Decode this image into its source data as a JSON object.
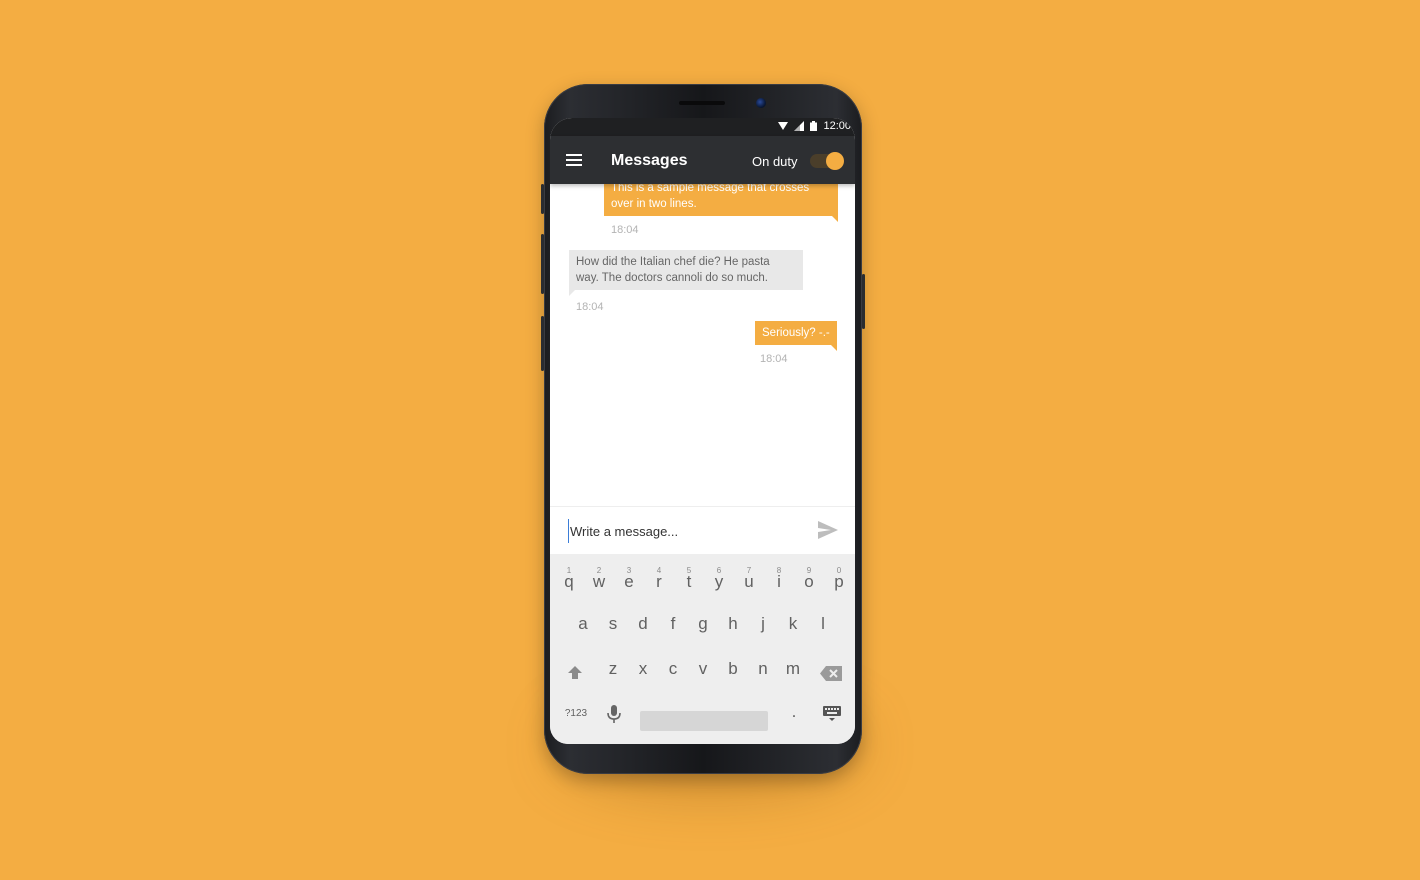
{
  "status_bar": {
    "time": "12:00"
  },
  "app_bar": {
    "title": "Messages",
    "duty_label": "On duty",
    "duty_on": true
  },
  "messages": [
    {
      "direction": "out",
      "text_line1": "This is a sample message that crosses",
      "text_line2": "over in two lines.",
      "time": "18:04"
    },
    {
      "direction": "in",
      "text_line1": "How did the Italian chef die? He pasta",
      "text_line2": "way. The doctors cannoli do so much.",
      "time": "18:04"
    },
    {
      "direction": "out",
      "text_line1": "Seriously? -.-",
      "time": "18:04"
    }
  ],
  "composer": {
    "placeholder": "Write a message..."
  },
  "keyboard": {
    "row1": [
      {
        "k": "q",
        "alt": "1"
      },
      {
        "k": "w",
        "alt": "2"
      },
      {
        "k": "e",
        "alt": "3"
      },
      {
        "k": "r",
        "alt": "4"
      },
      {
        "k": "t",
        "alt": "5"
      },
      {
        "k": "y",
        "alt": "6"
      },
      {
        "k": "u",
        "alt": "7"
      },
      {
        "k": "i",
        "alt": "8"
      },
      {
        "k": "o",
        "alt": "9"
      },
      {
        "k": "p",
        "alt": "0"
      }
    ],
    "row2": [
      "a",
      "s",
      "d",
      "f",
      "g",
      "h",
      "j",
      "k",
      "l"
    ],
    "row3": [
      "z",
      "x",
      "c",
      "v",
      "b",
      "n",
      "m"
    ],
    "symbols_label": "?123",
    "period_label": "."
  },
  "colors": {
    "accent": "#F4AD42",
    "appbar": "#2d2f32",
    "background": "#F4AD42"
  },
  "icons": [
    "menu-icon",
    "wifi-icon",
    "signal-icon",
    "battery-icon",
    "send-icon",
    "shift-icon",
    "backspace-icon",
    "mic-icon",
    "keyboard-icon"
  ]
}
